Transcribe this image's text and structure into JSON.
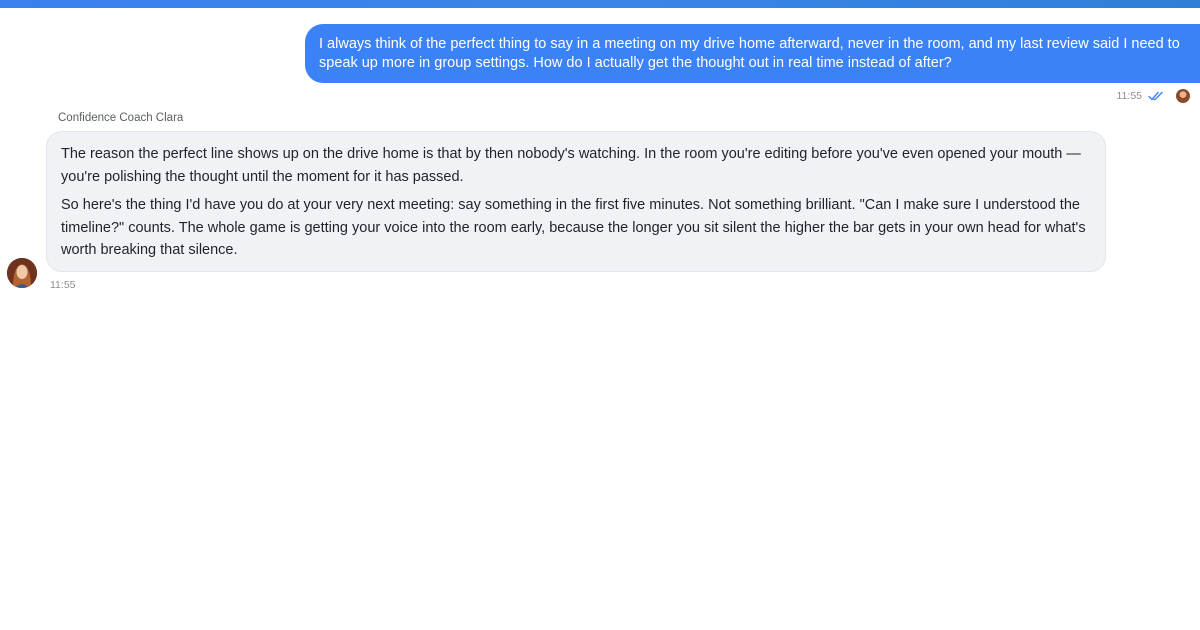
{
  "user_message": {
    "text": "I always think of the perfect thing to say in a meeting on my drive home afterward, never in the room, and my last review said I need to speak up more in group settings. How do I actually get the thought out in real time instead of after?",
    "time": "11:55",
    "status_icon": "double-check-icon"
  },
  "agent_message": {
    "name": "Confidence Coach Clara",
    "paragraphs": [
      "The reason the perfect line shows up on the drive home is that by then nobody's watching. In the room you're editing before you've even opened your mouth — you're polishing the thought until the moment for it has passed.",
      "So here's the thing I'd have you do at your very next meeting: say something in the first five minutes. Not something brilliant. \"Can I make sure I understood the timeline?\" counts. The whole game is getting your voice into the room early, because the longer you sit silent the higher the bar gets in your own head for what's worth breaking that silence."
    ],
    "time": "11:55"
  },
  "colors": {
    "accent": "#3b82f6",
    "agent_bubble": "#f0f2f5"
  }
}
